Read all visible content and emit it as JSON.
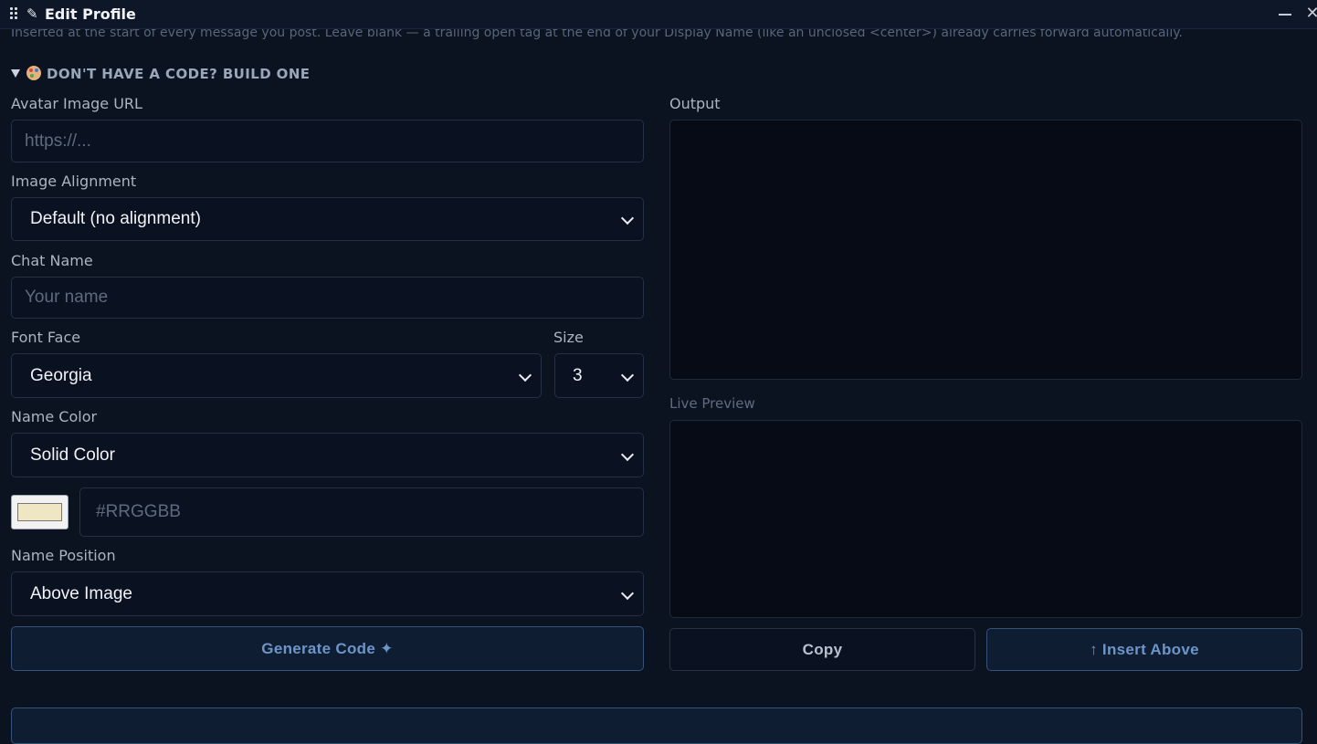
{
  "window": {
    "title": "Edit Profile",
    "minimize_icon": "minimize-icon",
    "close_icon": "close-icon"
  },
  "hint_text": "Inserted at the start of every message you post. Leave blank — a trailing open tag at the end of your Display Name (like an unclosed <center>) already carries forward automatically.",
  "builder": {
    "summary": "DON'T HAVE A CODE? BUILD ONE",
    "avatar_label": "Avatar Image URL",
    "avatar_placeholder": "https://...",
    "alignment_label": "Image Alignment",
    "alignment_value": "Default (no alignment)",
    "chat_name_label": "Chat Name",
    "chat_name_placeholder": "Your name",
    "font_face_label": "Font Face",
    "font_face_value": "Georgia",
    "size_label": "Size",
    "size_value": "3",
    "name_color_label": "Name Color",
    "name_color_value": "Solid Color",
    "color_swatch": "#efe6c3",
    "hex_placeholder": "#RRGGBB",
    "name_position_label": "Name Position",
    "name_position_value": "Above Image",
    "generate_button": "Generate Code ✦",
    "output_label": "Output",
    "preview_label": "Live Preview",
    "copy_button": "Copy",
    "insert_button": "↑ Insert Above"
  },
  "colors": {
    "background": "#0b1220",
    "accent": "#6c95c8"
  }
}
